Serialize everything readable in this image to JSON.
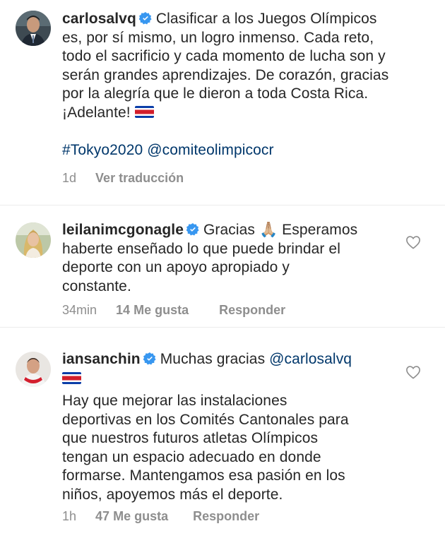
{
  "comments": [
    {
      "username": "carlosalvq",
      "verified": true,
      "text_lines": [
        "Clasificar a los Juegos Olímpicos",
        "es, por sí mismo, un logro inmenso. Cada reto,",
        "todo el sacrificio y cada momento de lucha son y",
        "serán grandes aprendizajes. De corazón, gracias",
        "por la alegría que le dieron a toda Costa Rica.",
        "¡Adelante!"
      ],
      "hashtag": "#Tokyo2020",
      "mention": "@comiteolimpicocr",
      "time": "1d",
      "translate": "Ver traducción"
    },
    {
      "username": "leilanimcgonagle",
      "verified": true,
      "text_lines": [
        "Gracias 🙏🏼 Esperamos",
        "haberte enseñado lo que puede brindar el",
        "deporte con un apoyo apropiado y",
        "constante."
      ],
      "time": "34min",
      "likes": "14 Me gusta",
      "reply": "Responder"
    },
    {
      "username": "iansanchin",
      "verified": true,
      "first_line": "Muchas gracias",
      "mention": "@carlosalvq",
      "text_lines": [
        "Hay que mejorar las instalaciones",
        "deportivas en los Comités Cantonales para",
        "que nuestros futuros atletas Olímpicos",
        "tengan un espacio adecuado en donde",
        "formarse. Mantengamos esa pasión en los",
        "niños, apoyemos más el deporte."
      ],
      "time": "1h",
      "likes": "47 Me gusta",
      "reply": "Responder"
    }
  ],
  "colors": {
    "text": "#262626",
    "secondary": "#8e8e8e",
    "link": "#00376b",
    "verified": "#3897f0"
  },
  "icons": [
    "verified-badge-icon",
    "heart-icon",
    "costa-rica-flag-icon"
  ]
}
